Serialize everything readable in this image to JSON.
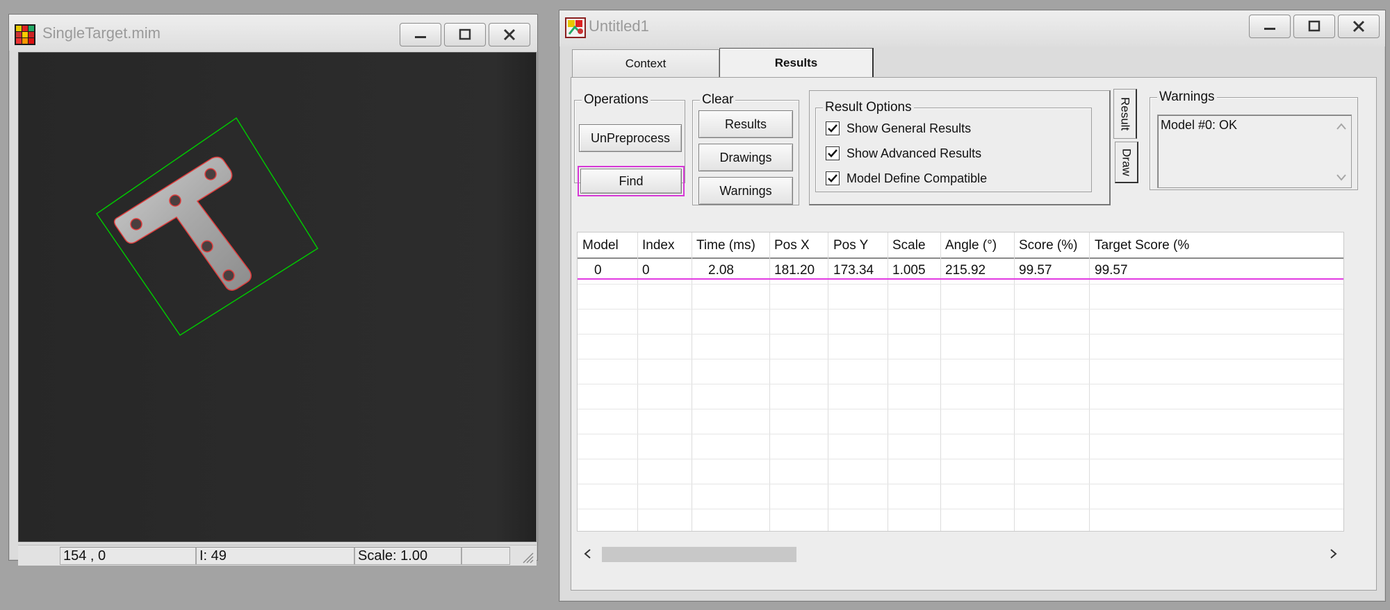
{
  "image_window": {
    "title": "SingleTarget.mim",
    "status": {
      "coords": "154 , 0",
      "intensity": "I: 49",
      "scale": "Scale: 1.00",
      "extra": ""
    }
  },
  "results_window": {
    "title": "Untitled1",
    "tabs": [
      {
        "label": "Context",
        "active": false
      },
      {
        "label": "Results",
        "active": true
      }
    ],
    "operations": {
      "label": "Operations",
      "unpreprocess": "UnPreprocess",
      "find": "Find"
    },
    "clear": {
      "label": "Clear",
      "results": "Results",
      "drawings": "Drawings",
      "warnings": "Warnings"
    },
    "result_options": {
      "label": "Result Options",
      "options": [
        {
          "label": "Show General Results",
          "checked": true
        },
        {
          "label": "Show Advanced Results",
          "checked": true
        },
        {
          "label": "Model Define Compatible",
          "checked": true
        }
      ],
      "side_tabs": [
        "Result",
        "Draw"
      ]
    },
    "warnings": {
      "label": "Warnings",
      "text": "Model #0: OK"
    },
    "grid": {
      "columns": [
        "Model",
        "Index",
        "Time (ms)",
        "Pos X",
        "Pos Y",
        "Scale",
        "Angle (°)",
        "Score (%)",
        "Target Score (%"
      ],
      "rows": [
        [
          "0",
          "0",
          "2.08",
          "181.20",
          "173.34",
          "1.005",
          "215.92",
          "99.57",
          "99.57"
        ]
      ]
    }
  },
  "colors": {
    "match_box": "#00c800",
    "contour": "#e03c3c",
    "highlight": "#e23be2"
  },
  "icons": {
    "minimize": "minimize-icon",
    "maximize": "maximize-icon",
    "close": "close-icon",
    "scroll_left": "chevron-left-icon",
    "scroll_right": "chevron-right-icon"
  }
}
